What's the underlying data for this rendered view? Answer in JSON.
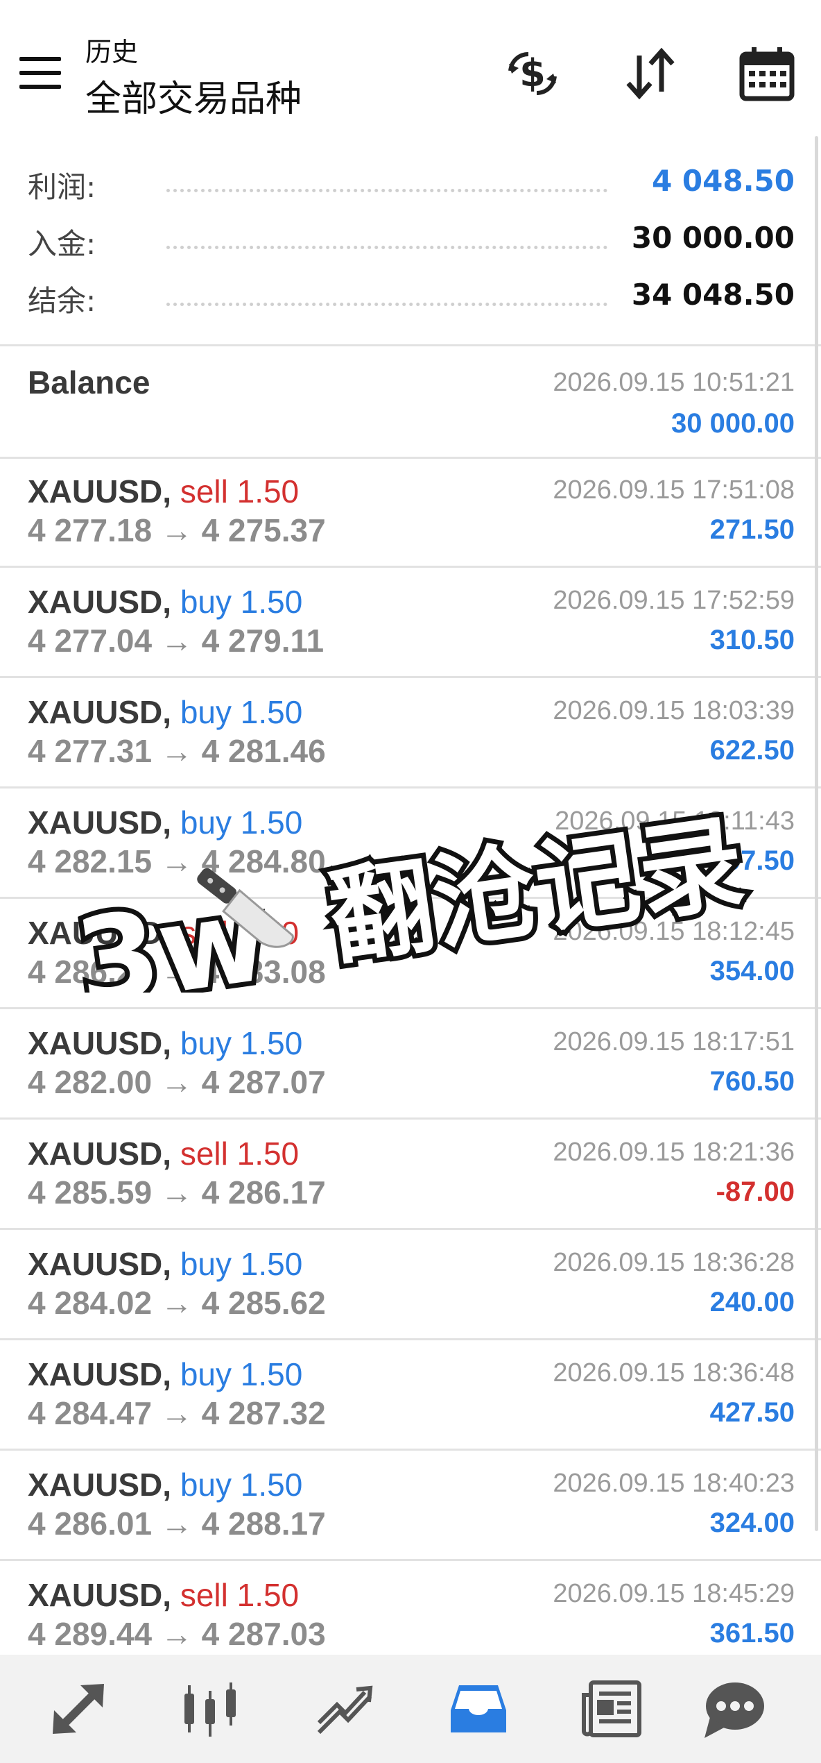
{
  "header": {
    "subtitle": "历史",
    "title": "全部交易品种",
    "icons": [
      "menu-icon",
      "currency-exchange-icon",
      "sort-icon",
      "calendar-icon"
    ]
  },
  "summary": {
    "profit_label": "利润:",
    "profit_value": "4 048.50",
    "deposit_label": "入金:",
    "deposit_value": "30 000.00",
    "balance_label": "结余:",
    "balance_value": "34 048.50"
  },
  "balance_entry": {
    "label": "Balance",
    "time": "2026.09.15 10:51:21",
    "amount": "30 000.00"
  },
  "trades": [
    {
      "symbol": "XAUUSD,",
      "type": "sell 1.50",
      "side": "sell",
      "prices": "4 277.18 → 4 275.37",
      "time": "2026.09.15 17:51:08",
      "profit": "271.50"
    },
    {
      "symbol": "XAUUSD,",
      "type": "buy 1.50",
      "side": "buy",
      "prices": "4 277.04 → 4 279.11",
      "time": "2026.09.15 17:52:59",
      "profit": "310.50"
    },
    {
      "symbol": "XAUUSD,",
      "type": "buy 1.50",
      "side": "buy",
      "prices": "4 277.31 → 4 281.46",
      "time": "2026.09.15 18:03:39",
      "profit": "622.50"
    },
    {
      "symbol": "XAUUSD,",
      "type": "buy 1.50",
      "side": "buy",
      "prices": "4 282.15 → 4 284.80",
      "time": "2026.09.15 18:11:43",
      "profit": "397.50"
    },
    {
      "symbol": "XAUUSD,",
      "type": "sell 1.50",
      "side": "sell",
      "prices": "4 286.24 → 4 283.08",
      "time": "2026.09.15 18:12:45",
      "profit": "354.00"
    },
    {
      "symbol": "XAUUSD,",
      "type": "buy 1.50",
      "side": "buy",
      "prices": "4 282.00 → 4 287.07",
      "time": "2026.09.15 18:17:51",
      "profit": "760.50"
    },
    {
      "symbol": "XAUUSD,",
      "type": "sell 1.50",
      "side": "sell",
      "prices": "4 285.59 → 4 286.17",
      "time": "2026.09.15 18:21:36",
      "profit": "-87.00"
    },
    {
      "symbol": "XAUUSD,",
      "type": "buy 1.50",
      "side": "buy",
      "prices": "4 284.02 → 4 285.62",
      "time": "2026.09.15 18:36:28",
      "profit": "240.00"
    },
    {
      "symbol": "XAUUSD,",
      "type": "buy 1.50",
      "side": "buy",
      "prices": "4 284.47 → 4 287.32",
      "time": "2026.09.15 18:36:48",
      "profit": "427.50"
    },
    {
      "symbol": "XAUUSD,",
      "type": "buy 1.50",
      "side": "buy",
      "prices": "4 286.01 → 4 288.17",
      "time": "2026.09.15 18:40:23",
      "profit": "324.00"
    },
    {
      "symbol": "XAUUSD,",
      "type": "sell 1.50",
      "side": "sell",
      "prices": "4 289.44 → 4 287.03",
      "time": "2026.09.15 18:45:29",
      "profit": "361.50"
    }
  ],
  "overlay": {
    "prefix": "3w",
    "caption": "翻沧记录",
    "emoji": "knife-emoji"
  },
  "bottom_nav": {
    "items": [
      "quotes-icon",
      "chart-icon",
      "trade-icon",
      "history-icon",
      "news-icon",
      "messages-icon"
    ],
    "active": "history-icon"
  },
  "colors": {
    "accent_blue": "#2a7de1",
    "sell_red": "#d3302f",
    "price_gray": "#8c8c8c",
    "time_gray": "#9a9a9a",
    "divider": "#e2e2e2",
    "nav_bg": "#f2f2f2"
  }
}
